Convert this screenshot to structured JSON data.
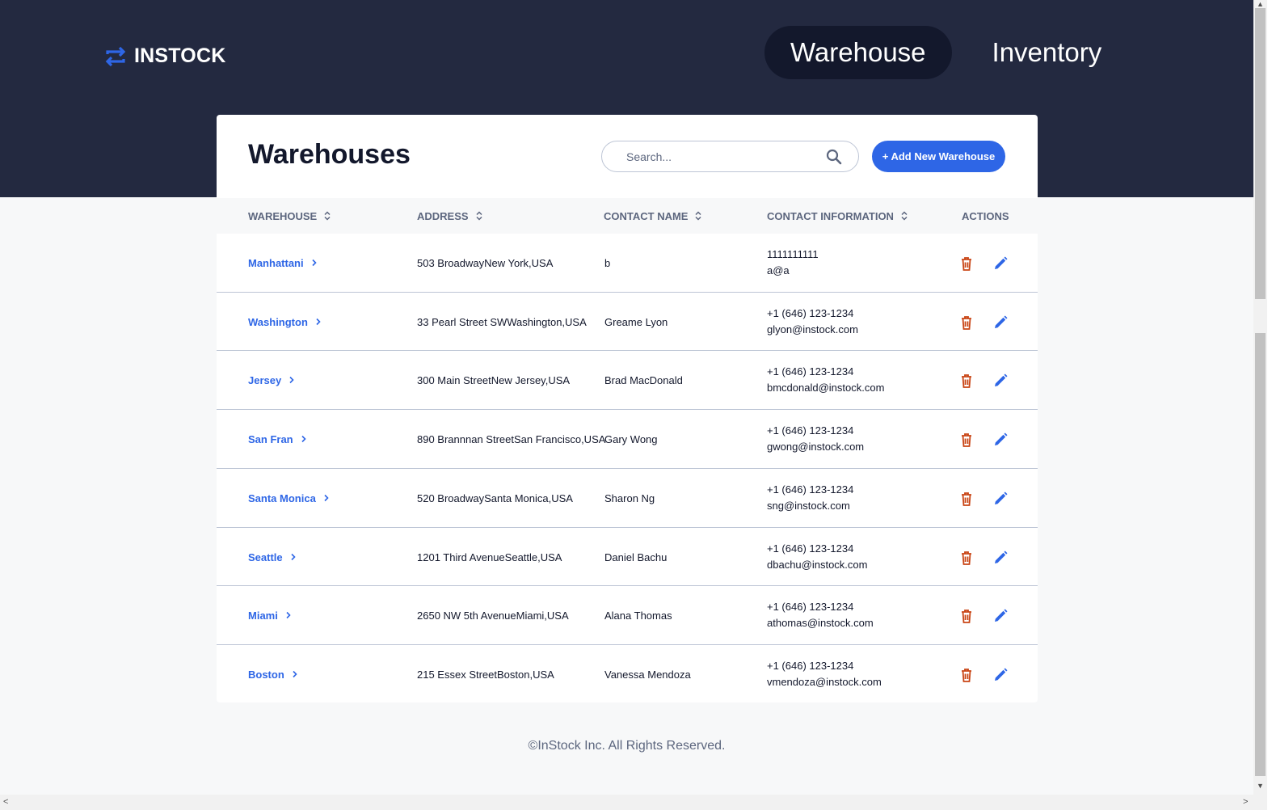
{
  "brand": {
    "logo_text": "INSTOCK",
    "icon": "swap-arrows-icon"
  },
  "nav": {
    "warehouse": "Warehouse",
    "inventory": "Inventory"
  },
  "page": {
    "title": "Warehouses"
  },
  "search": {
    "placeholder": "Search...",
    "value": ""
  },
  "add_button": "+ Add New Warehouse",
  "table": {
    "columns": [
      "WAREHOUSE",
      "ADDRESS",
      "CONTACT NAME",
      "CONTACT INFORMATION",
      "ACTIONS"
    ],
    "rows": [
      {
        "warehouse": "Manhattani",
        "address": "503 BroadwayNew York,USA",
        "contact": "b",
        "phone": "1111111111",
        "email": "a@a"
      },
      {
        "warehouse": "Washington",
        "address": "33 Pearl Street SWWashington,USA",
        "contact": "Greame Lyon",
        "phone": "+1 (646) 123-1234",
        "email": "glyon@instock.com"
      },
      {
        "warehouse": "Jersey",
        "address": "300 Main StreetNew Jersey,USA",
        "contact": "Brad MacDonald",
        "phone": "+1 (646) 123-1234",
        "email": "bmcdonald@instock.com"
      },
      {
        "warehouse": "San Fran",
        "address": "890 Brannnan StreetSan Francisco,USA",
        "contact": "Gary Wong",
        "phone": "+1 (646) 123-1234",
        "email": "gwong@instock.com"
      },
      {
        "warehouse": "Santa Monica",
        "address": "520 BroadwaySanta Monica,USA",
        "contact": "Sharon Ng",
        "phone": "+1 (646) 123-1234",
        "email": "sng@instock.com"
      },
      {
        "warehouse": "Seattle",
        "address": "1201 Third AvenueSeattle,USA",
        "contact": "Daniel Bachu",
        "phone": "+1 (646) 123-1234",
        "email": "dbachu@instock.com"
      },
      {
        "warehouse": "Miami",
        "address": "2650 NW 5th AvenueMiami,USA",
        "contact": "Alana Thomas",
        "phone": "+1 (646) 123-1234",
        "email": "athomas@instock.com"
      },
      {
        "warehouse": "Boston",
        "address": "215 Essex StreetBoston,USA",
        "contact": "Vanessa Mendoza",
        "phone": "+1 (646) 123-1234",
        "email": "vmendoza@instock.com"
      }
    ],
    "row_icons": {
      "link": "chevron-right-icon",
      "delete": "trash-icon",
      "edit": "pencil-icon",
      "sort": "sort-icon"
    }
  },
  "footer": "©InStock Inc. All Rights Reserved.",
  "colors": {
    "header_bg": "#232940",
    "nav_active_bg": "#13182c",
    "accent": "#2e66e6",
    "delete": "#c94515",
    "text_primary": "#13182c",
    "text_secondary": "#5c667e",
    "border": "#bdc5d5",
    "page_bg": "#f7f8f9"
  }
}
